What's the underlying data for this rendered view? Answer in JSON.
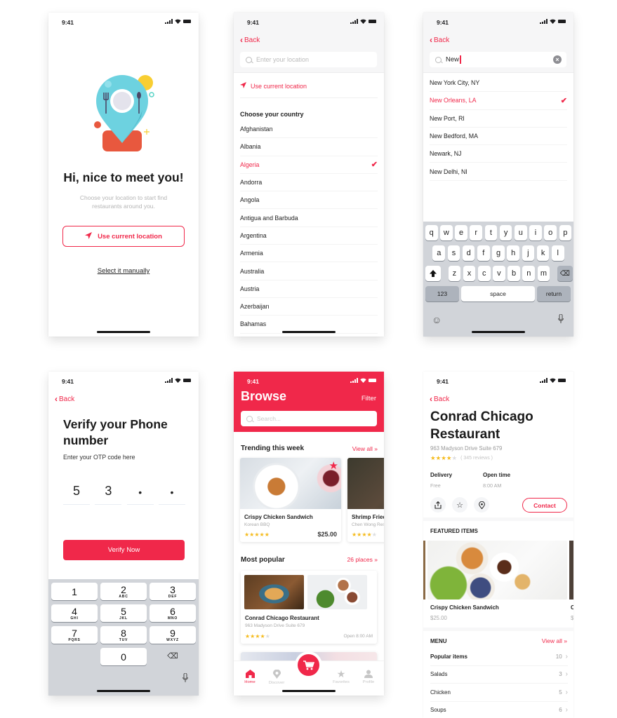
{
  "status_bar": {
    "time": "9:41"
  },
  "colors": {
    "accent": "#f0284a",
    "star": "#f5bb1c",
    "keyboard_bg": "#d1d4d9"
  },
  "welcome": {
    "title": "Hi, nice to meet you!",
    "subtitle": "Choose your location to start find restaurants around you.",
    "use_location_label": "Use current location",
    "manual_link": "Select it manually",
    "illustration_icon": "map-pin-plate-icon"
  },
  "country_picker": {
    "back_label": "Back",
    "search_placeholder": "Enter your location",
    "use_location_label": "Use current location",
    "section_title": "Choose your country",
    "countries": [
      {
        "name": "Afghanistan",
        "selected": false
      },
      {
        "name": "Albania",
        "selected": false
      },
      {
        "name": "Algeria",
        "selected": true
      },
      {
        "name": "Andorra",
        "selected": false
      },
      {
        "name": "Angola",
        "selected": false
      },
      {
        "name": "Antigua and Barbuda",
        "selected": false
      },
      {
        "name": "Argentina",
        "selected": false
      },
      {
        "name": "Armenia",
        "selected": false
      },
      {
        "name": "Australia",
        "selected": false
      },
      {
        "name": "Austria",
        "selected": false
      },
      {
        "name": "Azerbaijan",
        "selected": false
      },
      {
        "name": "Bahamas",
        "selected": false
      }
    ]
  },
  "city_search": {
    "back_label": "Back",
    "search_value": "New",
    "results": [
      {
        "name": "New York City, NY",
        "selected": false
      },
      {
        "name": "New Orleans, LA",
        "selected": true
      },
      {
        "name": "New Port, RI",
        "selected": false
      },
      {
        "name": "New Bedford, MA",
        "selected": false
      },
      {
        "name": "Newark, NJ",
        "selected": false
      },
      {
        "name": "New Delhi, NI",
        "selected": false
      }
    ],
    "keyboard": {
      "row1": [
        "q",
        "w",
        "e",
        "r",
        "t",
        "y",
        "u",
        "i",
        "o",
        "p"
      ],
      "row2": [
        "a",
        "s",
        "d",
        "f",
        "g",
        "h",
        "j",
        "k",
        "l"
      ],
      "row3": [
        "z",
        "x",
        "c",
        "v",
        "b",
        "n",
        "m"
      ],
      "numbers_key": "123",
      "space_key": "space",
      "return_key": "return"
    }
  },
  "verify": {
    "back_label": "Back",
    "title": "Verify your Phone number",
    "subtitle": "Enter your OTP code here",
    "otp": [
      "5",
      "3",
      "•",
      "•"
    ],
    "button_label": "Verify Now",
    "numpad": [
      {
        "n": "1",
        "s": ""
      },
      {
        "n": "2",
        "s": "ABC"
      },
      {
        "n": "3",
        "s": "DEF"
      },
      {
        "n": "4",
        "s": "GHI"
      },
      {
        "n": "5",
        "s": "JKL"
      },
      {
        "n": "6",
        "s": "MNO"
      },
      {
        "n": "7",
        "s": "PQRS"
      },
      {
        "n": "8",
        "s": "TUV"
      },
      {
        "n": "9",
        "s": "WXYZ"
      },
      {
        "n": "0",
        "s": ""
      }
    ]
  },
  "browse": {
    "title": "Browse",
    "filter_label": "Filter",
    "search_placeholder": "Search...",
    "trending": {
      "title": "Trending this week",
      "link": "View all »",
      "cards": [
        {
          "name": "Crispy Chicken Sandwich",
          "category": "Korean BBQ",
          "rating": 5,
          "price": "$25.00",
          "favorite": true
        },
        {
          "name": "Shrimp Fried Rice",
          "category": "Chen Wong Restaurant",
          "rating": 4,
          "price": "",
          "favorite": false
        }
      ]
    },
    "popular": {
      "title": "Most popular",
      "link": "26 places »",
      "cards": [
        {
          "name": "Conrad Chicago Restaurant",
          "address": "963 Madyson Drive Suite 679",
          "rating": 4,
          "open": "Open 8:00 AM"
        }
      ]
    },
    "tabs": [
      {
        "label": "Home",
        "icon": "home-icon",
        "active": true
      },
      {
        "label": "Discover",
        "icon": "location-pin-icon",
        "active": false
      },
      {
        "label": "",
        "icon": "cart-icon",
        "active": false
      },
      {
        "label": "Favorites",
        "icon": "star-icon",
        "active": false
      },
      {
        "label": "Profile",
        "icon": "user-icon",
        "active": false
      }
    ]
  },
  "restaurant": {
    "back_label": "Back",
    "name": "Conrad Chicago Restaurant",
    "address": "963 Madyson Drive Suite 679",
    "rating": 4,
    "reviews": "( 345 reviews )",
    "delivery_label": "Delivery",
    "delivery_value": "Free",
    "open_label": "Open time",
    "open_value": "8:00 AM",
    "contact_label": "Contact",
    "featured_title": "FEATURED ITEMS",
    "featured": [
      {
        "name": "Crispy Chicken Sandwich",
        "price": "$25.00"
      },
      {
        "name": "C",
        "price": "$"
      }
    ],
    "menu_title": "MENU",
    "menu_link": "View all »",
    "menu": [
      {
        "name": "Popular items",
        "count": "10"
      },
      {
        "name": "Salads",
        "count": "3"
      },
      {
        "name": "Chicken",
        "count": "5"
      },
      {
        "name": "Soups",
        "count": "6"
      }
    ]
  }
}
